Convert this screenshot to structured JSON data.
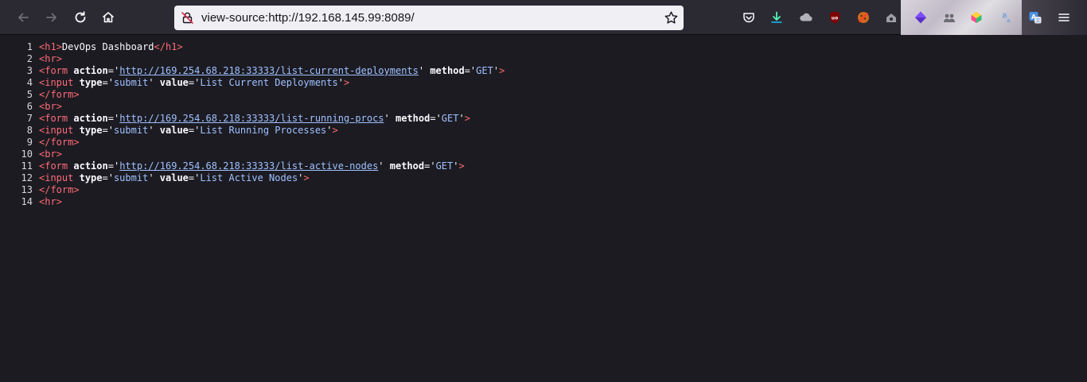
{
  "browser": {
    "url": "view-source:http://192.168.145.99:8089/",
    "icons": {
      "back": "arrow-left-icon",
      "forward": "arrow-right-icon",
      "reload": "reload-icon",
      "home": "home-icon",
      "menu": "hamburger-icon"
    }
  },
  "source_lines": [
    {
      "n": "1",
      "parts": [
        [
          "tag",
          "<"
        ],
        [
          "tn",
          "h1"
        ],
        [
          "tag",
          ">"
        ],
        [
          "pl",
          "DevOps Dashboard"
        ],
        [
          "tag",
          "</"
        ],
        [
          "tn",
          "h1"
        ],
        [
          "tag",
          ">"
        ]
      ]
    },
    {
      "n": "2",
      "parts": [
        [
          "tag",
          "<"
        ],
        [
          "tn",
          "hr"
        ],
        [
          "tag",
          ">"
        ]
      ]
    },
    {
      "n": "3",
      "parts": [
        [
          "tag",
          "<"
        ],
        [
          "tn",
          "form"
        ],
        [
          "pl",
          " "
        ],
        [
          "an",
          "action"
        ],
        [
          "pl",
          "='"
        ],
        [
          "lnk",
          "http://169.254.68.218:33333/list-current-deployments"
        ],
        [
          "pl",
          "' "
        ],
        [
          "an",
          "method"
        ],
        [
          "pl",
          "='"
        ],
        [
          "av",
          "GET"
        ],
        [
          "pl",
          "'"
        ],
        [
          "tag",
          ">"
        ]
      ]
    },
    {
      "n": "4",
      "parts": [
        [
          "tag",
          "<"
        ],
        [
          "tn",
          "input"
        ],
        [
          "pl",
          " "
        ],
        [
          "an",
          "type"
        ],
        [
          "pl",
          "='"
        ],
        [
          "av",
          "submit"
        ],
        [
          "pl",
          "' "
        ],
        [
          "an",
          "value"
        ],
        [
          "pl",
          "='"
        ],
        [
          "av",
          "List Current Deployments"
        ],
        [
          "pl",
          "'"
        ],
        [
          "tag",
          ">"
        ]
      ]
    },
    {
      "n": "5",
      "parts": [
        [
          "tag",
          "</"
        ],
        [
          "tn",
          "form"
        ],
        [
          "tag",
          ">"
        ]
      ]
    },
    {
      "n": "6",
      "parts": [
        [
          "tag",
          "<"
        ],
        [
          "tn",
          "br"
        ],
        [
          "tag",
          ">"
        ]
      ]
    },
    {
      "n": "7",
      "parts": [
        [
          "tag",
          "<"
        ],
        [
          "tn",
          "form"
        ],
        [
          "pl",
          " "
        ],
        [
          "an",
          "action"
        ],
        [
          "pl",
          "='"
        ],
        [
          "lnk",
          "http://169.254.68.218:33333/list-running-procs"
        ],
        [
          "pl",
          "' "
        ],
        [
          "an",
          "method"
        ],
        [
          "pl",
          "='"
        ],
        [
          "av",
          "GET"
        ],
        [
          "pl",
          "'"
        ],
        [
          "tag",
          ">"
        ]
      ]
    },
    {
      "n": "8",
      "parts": [
        [
          "tag",
          "<"
        ],
        [
          "tn",
          "input"
        ],
        [
          "pl",
          " "
        ],
        [
          "an",
          "type"
        ],
        [
          "pl",
          "='"
        ],
        [
          "av",
          "submit"
        ],
        [
          "pl",
          "' "
        ],
        [
          "an",
          "value"
        ],
        [
          "pl",
          "='"
        ],
        [
          "av",
          "List Running Processes"
        ],
        [
          "pl",
          "'"
        ],
        [
          "tag",
          ">"
        ]
      ]
    },
    {
      "n": "9",
      "parts": [
        [
          "tag",
          "</"
        ],
        [
          "tn",
          "form"
        ],
        [
          "tag",
          ">"
        ]
      ]
    },
    {
      "n": "10",
      "parts": [
        [
          "tag",
          "<"
        ],
        [
          "tn",
          "br"
        ],
        [
          "tag",
          ">"
        ]
      ]
    },
    {
      "n": "11",
      "parts": [
        [
          "tag",
          "<"
        ],
        [
          "tn",
          "form"
        ],
        [
          "pl",
          " "
        ],
        [
          "an",
          "action"
        ],
        [
          "pl",
          "='"
        ],
        [
          "lnk",
          "http://169.254.68.218:33333/list-active-nodes"
        ],
        [
          "pl",
          "' "
        ],
        [
          "an",
          "method"
        ],
        [
          "pl",
          "='"
        ],
        [
          "av",
          "GET"
        ],
        [
          "pl",
          "'"
        ],
        [
          "tag",
          ">"
        ]
      ]
    },
    {
      "n": "12",
      "parts": [
        [
          "tag",
          "<"
        ],
        [
          "tn",
          "input"
        ],
        [
          "pl",
          " "
        ],
        [
          "an",
          "type"
        ],
        [
          "pl",
          "='"
        ],
        [
          "av",
          "submit"
        ],
        [
          "pl",
          "' "
        ],
        [
          "an",
          "value"
        ],
        [
          "pl",
          "='"
        ],
        [
          "av",
          "List Active Nodes"
        ],
        [
          "pl",
          "'"
        ],
        [
          "tag",
          ">"
        ]
      ]
    },
    {
      "n": "13",
      "parts": [
        [
          "tag",
          "</"
        ],
        [
          "tn",
          "form"
        ],
        [
          "tag",
          ">"
        ]
      ]
    },
    {
      "n": "14",
      "parts": [
        [
          "tag",
          "<"
        ],
        [
          "tn",
          "hr"
        ],
        [
          "tag",
          ">"
        ]
      ]
    }
  ],
  "colors": {
    "toolbar_bg": "#2b2a33",
    "content_bg": "#1c1b22",
    "tag": "#ff6b7a",
    "attr_value": "#9fc1ff"
  }
}
